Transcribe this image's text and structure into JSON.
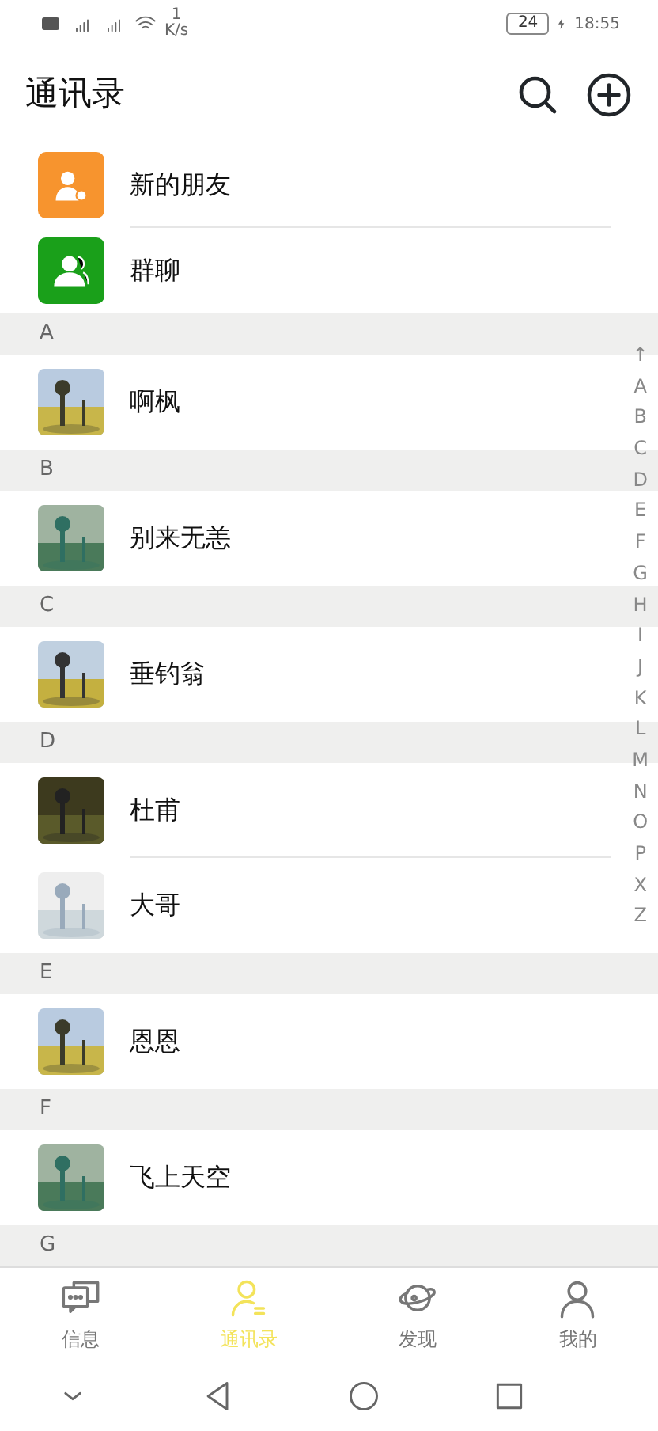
{
  "status_bar": {
    "speed_value": "1",
    "speed_unit": "K/s",
    "battery": "24",
    "time": "18:55"
  },
  "header": {
    "title": "通讯录"
  },
  "shortcuts": [
    {
      "kind": "new-friend",
      "label": "新的朋友",
      "color": "#f7942e"
    },
    {
      "kind": "group",
      "label": "群聊",
      "color": "#1aa01a"
    }
  ],
  "sections": [
    {
      "letter": "A",
      "contacts": [
        {
          "name": "啊枫",
          "kind": "picture"
        }
      ]
    },
    {
      "letter": "B",
      "contacts": [
        {
          "name": "别来无恙",
          "kind": "picture"
        }
      ]
    },
    {
      "letter": "C",
      "contacts": [
        {
          "name": "垂钓翁",
          "kind": "picture"
        }
      ]
    },
    {
      "letter": "D",
      "contacts": [
        {
          "name": "杜甫",
          "kind": "picture"
        },
        {
          "name": "大哥",
          "kind": "picture"
        }
      ]
    },
    {
      "letter": "E",
      "contacts": [
        {
          "name": "恩恩",
          "kind": "picture"
        }
      ]
    },
    {
      "letter": "F",
      "contacts": [
        {
          "name": "飞上天空",
          "kind": "picture"
        }
      ]
    },
    {
      "letter": "G"
    }
  ],
  "index_bar": [
    "↑",
    "A",
    "B",
    "C",
    "D",
    "E",
    "F",
    "G",
    "H",
    "I",
    "J",
    "K",
    "L",
    "M",
    "N",
    "O",
    "P",
    "X",
    "Z"
  ],
  "tabs": [
    {
      "label": "信息",
      "kind": "chat",
      "selected": false
    },
    {
      "label": "通讯录",
      "kind": "contacts",
      "selected": true
    },
    {
      "label": "发现",
      "kind": "planet",
      "selected": false
    },
    {
      "label": "我的",
      "kind": "person",
      "selected": false
    }
  ]
}
